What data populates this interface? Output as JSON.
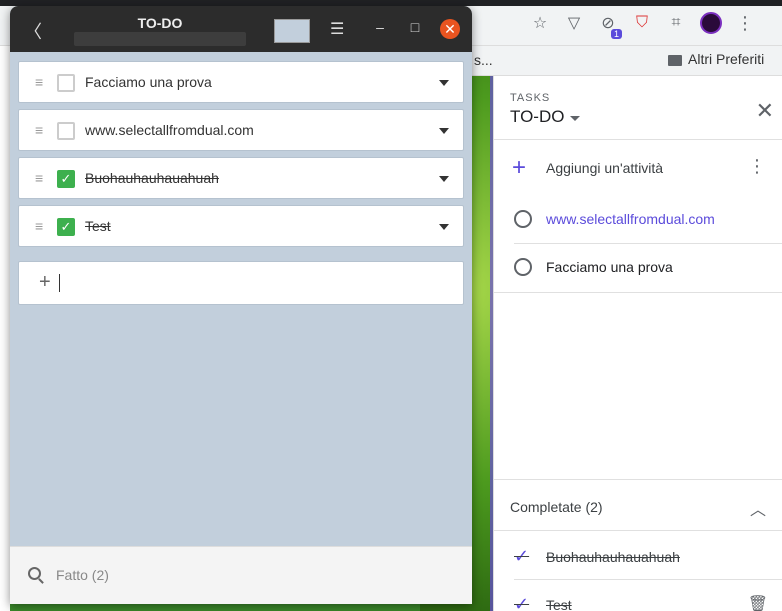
{
  "browser": {
    "extension_badge": "1",
    "bookmark_partial": "s...",
    "bookmark_folder": "Altri Preferiti",
    "menu_icon": "⋮"
  },
  "todo_app": {
    "title": "TO-DO",
    "items": [
      {
        "text": "Facciamo una prova",
        "done": false
      },
      {
        "text": "www.selectallfromdual.com",
        "done": false
      },
      {
        "text": "Buohauhauhauahuah",
        "done": true
      },
      {
        "text": "Test",
        "done": true
      }
    ],
    "footer": "Fatto (2)",
    "bg_color": "#c2cfdc"
  },
  "tasks_panel": {
    "label": "TASKS",
    "list_name": "TO-DO",
    "add_label": "Aggiungi un'attività",
    "tasks": [
      {
        "text": "www.selectallfromdual.com",
        "is_link": true
      },
      {
        "text": "Facciamo una prova",
        "is_link": false
      }
    ],
    "completed_header": "Completate (2)",
    "completed": [
      "Buohauhauhauahuah",
      "Test"
    ],
    "accent": "#5b4bdb"
  }
}
